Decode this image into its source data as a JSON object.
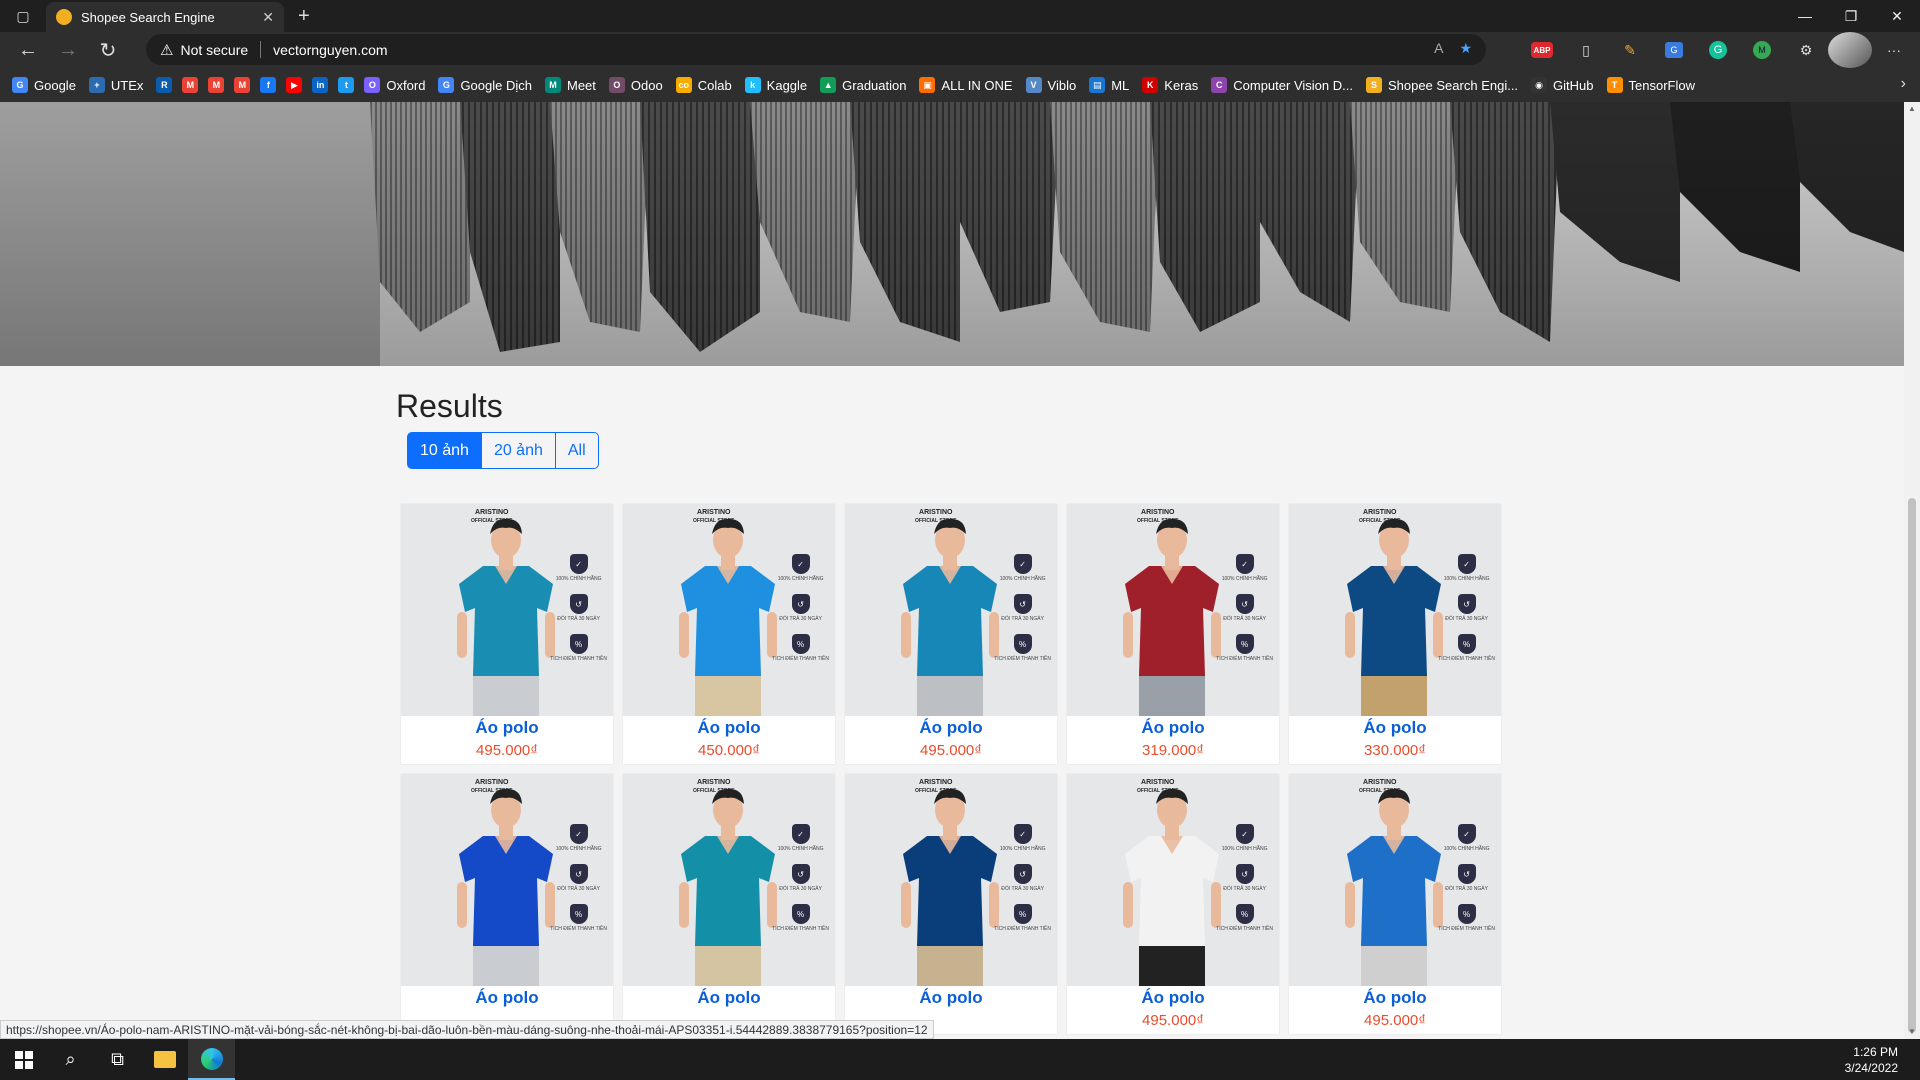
{
  "browser": {
    "tab_title": "Shopee Search Engine",
    "new_tab": "+",
    "close_tab": "✕",
    "security_label": "Not secure",
    "url": "vectornguyen.com",
    "bookmarks": [
      {
        "label": "Google",
        "color": "#4285f4",
        "icon": "G"
      },
      {
        "label": "UTEx",
        "color": "#2b6cb0",
        "icon": "+"
      },
      {
        "label": "",
        "color": "#0b5cad",
        "icon": "R"
      },
      {
        "label": "",
        "color": "#ea4335",
        "icon": "M"
      },
      {
        "label": "",
        "color": "#ea4335",
        "icon": "M"
      },
      {
        "label": "",
        "color": "#ea4335",
        "icon": "M"
      },
      {
        "label": "",
        "color": "#1877f2",
        "icon": "f"
      },
      {
        "label": "",
        "color": "#ff0000",
        "icon": "▶"
      },
      {
        "label": "",
        "color": "#0a66c2",
        "icon": "in"
      },
      {
        "label": "",
        "color": "#1d9bf0",
        "icon": "t"
      },
      {
        "label": "Oxford",
        "color": "#7b61ff",
        "icon": "O"
      },
      {
        "label": "Google Dịch",
        "color": "#4285f4",
        "icon": "G"
      },
      {
        "label": "Meet",
        "color": "#00897b",
        "icon": "M"
      },
      {
        "label": "Odoo",
        "color": "#714b67",
        "icon": "O"
      },
      {
        "label": "Colab",
        "color": "#f9ab00",
        "icon": "co"
      },
      {
        "label": "Kaggle",
        "color": "#20beff",
        "icon": "k"
      },
      {
        "label": "Graduation",
        "color": "#0f9d58",
        "icon": "▲"
      },
      {
        "label": "ALL IN ONE",
        "color": "#ff6d00",
        "icon": "▣"
      },
      {
        "label": "Viblo",
        "color": "#5488c7",
        "icon": "V"
      },
      {
        "label": "ML",
        "color": "#1976d2",
        "icon": "▤"
      },
      {
        "label": "Keras",
        "color": "#d00000",
        "icon": "K"
      },
      {
        "label": "Computer Vision D...",
        "color": "#8e44ad",
        "icon": "C"
      },
      {
        "label": "Shopee Search Engi...",
        "color": "#f2b021",
        "icon": "S"
      },
      {
        "label": "GitHub",
        "color": "#333333",
        "icon": "◉"
      },
      {
        "label": "TensorFlow",
        "color": "#ff8f00",
        "icon": "T"
      }
    ],
    "status_url": "https://shopee.vn/Áo-polo-nam-ARISTINO-mặt-vải-bóng-sắc-nét-không-bị-bai-dão-luôn-bền-màu-dáng-suông-nhe-thoải-mái-APS03351-i.54442889.3838779165?position=12"
  },
  "page": {
    "results_title": "Results",
    "filters": [
      {
        "label": "10 ảnh",
        "active": true
      },
      {
        "label": "20 ảnh",
        "active": false
      },
      {
        "label": "All",
        "active": false
      }
    ],
    "products": [
      {
        "name": "Áo polo",
        "price": "495.000₫",
        "shirt": "#1a8db3",
        "pants": "#c9cdd2",
        "skin": "#e9b99c"
      },
      {
        "name": "Áo polo",
        "price": "450.000₫",
        "shirt": "#1e90df",
        "pants": "#d8c6a3",
        "skin": "#e9b99c"
      },
      {
        "name": "Áo polo",
        "price": "495.000₫",
        "shirt": "#1787b8",
        "pants": "#bcc0c4",
        "skin": "#e9b99c"
      },
      {
        "name": "Áo polo",
        "price": "319.000₫",
        "shirt": "#9f1f2b",
        "pants": "#9aa0a8",
        "skin": "#e9b99c"
      },
      {
        "name": "Áo polo",
        "price": "330.000₫",
        "shirt": "#0d4a83",
        "pants": "#c2a16d",
        "skin": "#e9b99c"
      },
      {
        "name": "Áo polo",
        "price": "",
        "shirt": "#1449c7",
        "pants": "#c9cdd2",
        "skin": "#e9b99c"
      },
      {
        "name": "Áo polo",
        "price": "",
        "shirt": "#138fa8",
        "pants": "#d5c4a2",
        "skin": "#e9b99c"
      },
      {
        "name": "Áo polo",
        "price": "",
        "shirt": "#0a3e7b",
        "pants": "#c7b28f",
        "skin": "#e9b99c"
      },
      {
        "name": "Áo polo",
        "price": "495.000₫",
        "shirt": "#f2f2f2",
        "pants": "#222222",
        "skin": "#e9b99c"
      },
      {
        "name": "Áo polo",
        "price": "495.000₫",
        "shirt": "#1d6fc8",
        "pants": "#cfcfcf",
        "skin": "#e9b99c"
      }
    ],
    "product_logo": "ARISTINO",
    "product_logo_sub": "OFFICIAL STORE",
    "badge_captions": [
      "100% CHÍNH HÃNG",
      "ĐỔI TRẢ 30 NGÀY",
      "TÍCH ĐIỂM THANH TIỀN"
    ]
  },
  "taskbar": {
    "time": "1:26 PM",
    "date": "3/24/2022"
  }
}
